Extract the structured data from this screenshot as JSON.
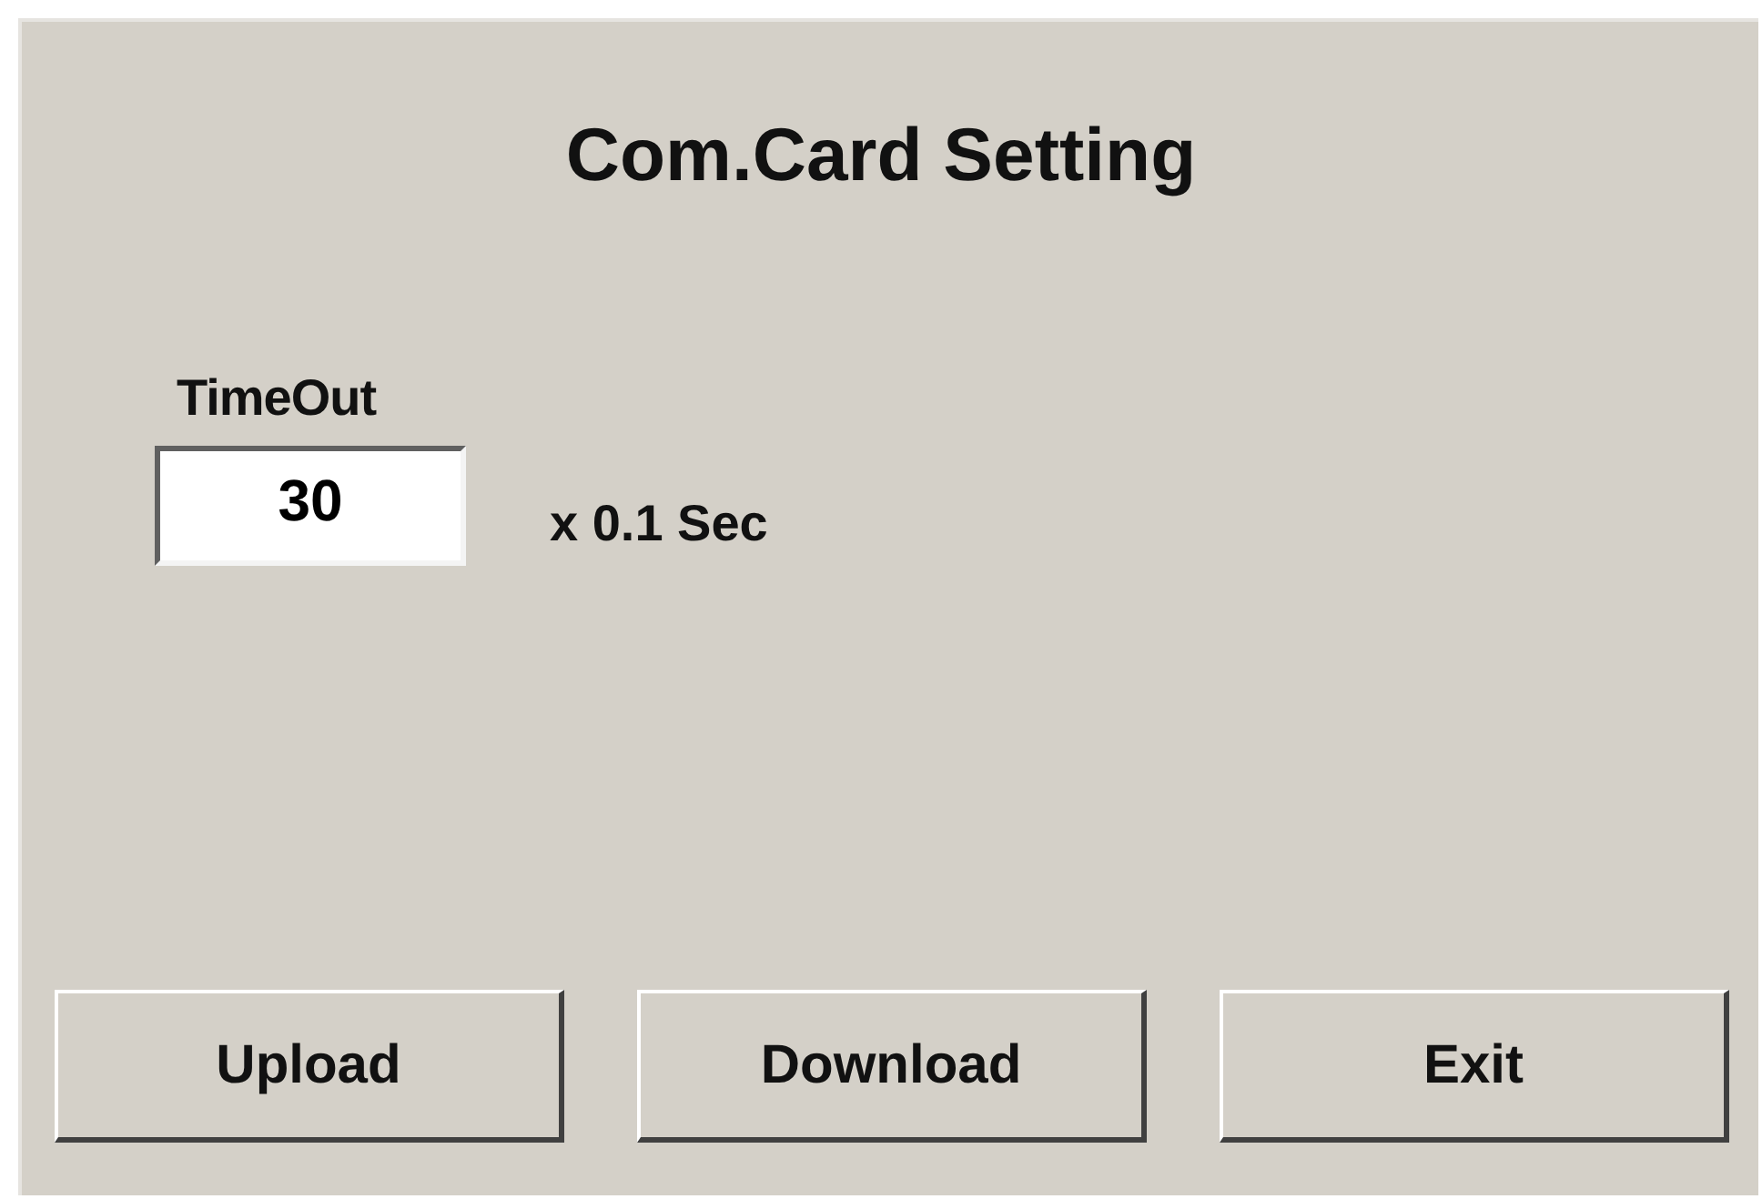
{
  "title": "Com.Card Setting",
  "timeout": {
    "label": "TimeOut",
    "value": "30",
    "unit": "x 0.1 Sec"
  },
  "buttons": [
    "Upload",
    "Download",
    "Exit"
  ]
}
